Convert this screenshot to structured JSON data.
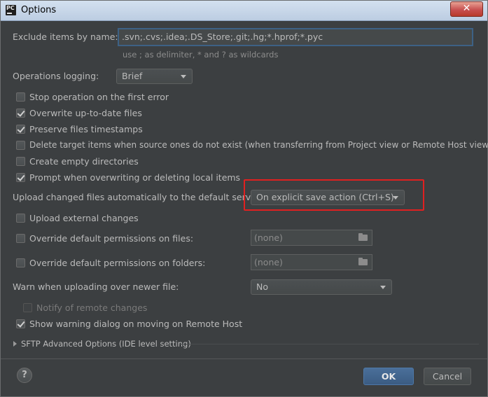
{
  "window": {
    "title": "Options",
    "app_icon_text": "PC",
    "close_symbol": "✕"
  },
  "exclude": {
    "label": "Exclude items by name:",
    "value": ".svn;.cvs;.idea;.DS_Store;.git;.hg;*.hprof;*.pyc",
    "hint": "use ; as delimiter, * and ? as wildcards"
  },
  "operations_logging": {
    "label": "Operations logging:",
    "value": "Brief"
  },
  "checkboxes": [
    {
      "label": "Stop operation on the first error",
      "checked": false
    },
    {
      "label": "Overwrite up-to-date files",
      "checked": true
    },
    {
      "label": "Preserve files timestamps",
      "checked": true
    },
    {
      "label": "Delete target items when source ones do not exist (when transferring from Project view or Remote Host view)",
      "checked": false
    },
    {
      "label": "Create empty directories",
      "checked": false
    },
    {
      "label": "Prompt when overwriting or deleting local items",
      "checked": true
    }
  ],
  "upload_changed": {
    "label": "Upload changed files automatically to the default server",
    "value": "On explicit save action (Ctrl+S)"
  },
  "upload_external": {
    "label": "Upload external changes",
    "checked": false
  },
  "override_files": {
    "label": "Override default permissions on files:",
    "checked": false,
    "value": "(none)"
  },
  "override_folders": {
    "label": "Override default permissions on folders:",
    "checked": false,
    "value": "(none)"
  },
  "warn_newer": {
    "label": "Warn when uploading over newer file:",
    "value": "No"
  },
  "notify_remote": {
    "label": "Notify of remote changes",
    "checked": false,
    "disabled": true
  },
  "show_warning": {
    "label": "Show warning dialog on moving on Remote Host",
    "checked": true
  },
  "sftp_advanced": {
    "label": "SFTP Advanced Options (IDE level setting)"
  },
  "footer": {
    "help_symbol": "?",
    "ok_label": "OK",
    "cancel_label": "Cancel"
  },
  "colors": {
    "background": "#3c3f41",
    "text": "#bbbbbb",
    "accent_focus": "#3d6185",
    "ok_button": "#3b5c82",
    "highlight_annotation": "#e02020"
  },
  "icons": [
    "app-icon",
    "close-icon",
    "chevron-down-icon",
    "folder-icon",
    "help-icon",
    "chevron-right-icon",
    "check-icon"
  ]
}
